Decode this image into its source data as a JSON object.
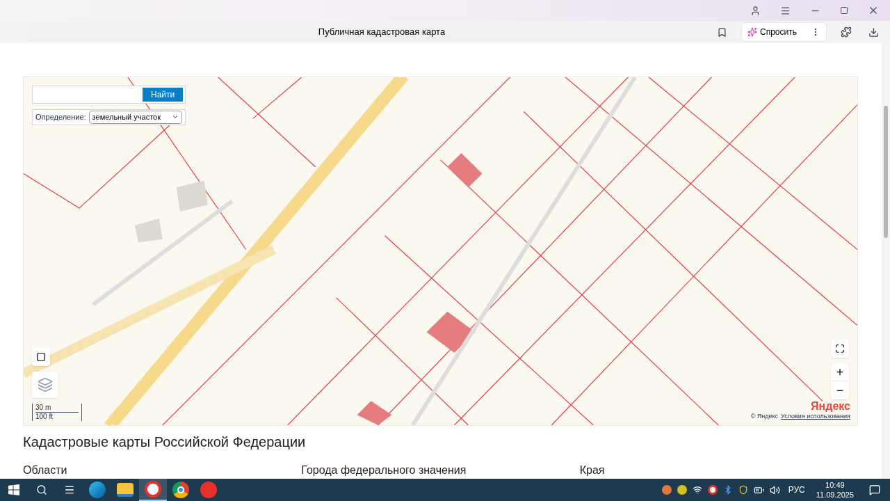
{
  "browser": {
    "tab_title": "Публичная кадастровая карта",
    "ask_button": "Спросить"
  },
  "map": {
    "search": {
      "button": "Найти"
    },
    "definition": {
      "label": "Определение:",
      "value": "земельный участок"
    },
    "scale": [
      "30 m",
      "100 ft"
    ],
    "zoom_in": "+",
    "zoom_out": "−",
    "logo": "Яндекс",
    "copyright": "© Яндекс",
    "terms_link": "Условия использования"
  },
  "page": {
    "heading": "Кадастровые карты Российской Федерации",
    "columns": [
      "Области",
      "Города федерального значения",
      "Края"
    ]
  },
  "taskbar": {
    "apps": [
      {
        "kind": "edge",
        "selected": false
      },
      {
        "kind": "folder",
        "selected": false
      },
      {
        "kind": "yandex-browser",
        "selected": true
      },
      {
        "kind": "chrome",
        "selected": false
      },
      {
        "kind": "yandex",
        "selected": false
      }
    ],
    "language": "РУС",
    "time": "10:49",
    "date": "11.09.2025"
  }
}
